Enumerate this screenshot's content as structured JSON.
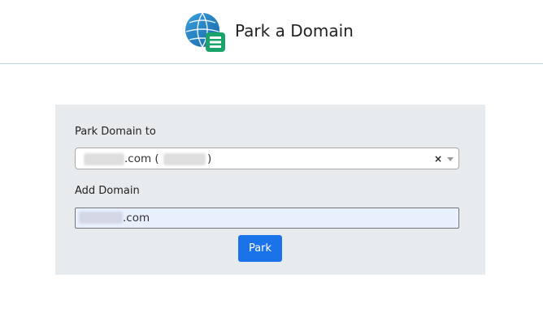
{
  "header": {
    "title": "Park a Domain",
    "logo_icon": "globe-list-icon"
  },
  "form": {
    "park_to_label": "Park Domain to",
    "park_to_value_suffix": ".com (",
    "park_to_value_close": ")",
    "add_domain_label": "Add Domain",
    "add_domain_value_suffix": ".com",
    "submit_label": "Park",
    "clear_symbol": "×"
  },
  "colors": {
    "accent": "#1a73e8",
    "panel_bg": "#e8ebee",
    "input_autofill_bg": "#e8f0fe"
  }
}
